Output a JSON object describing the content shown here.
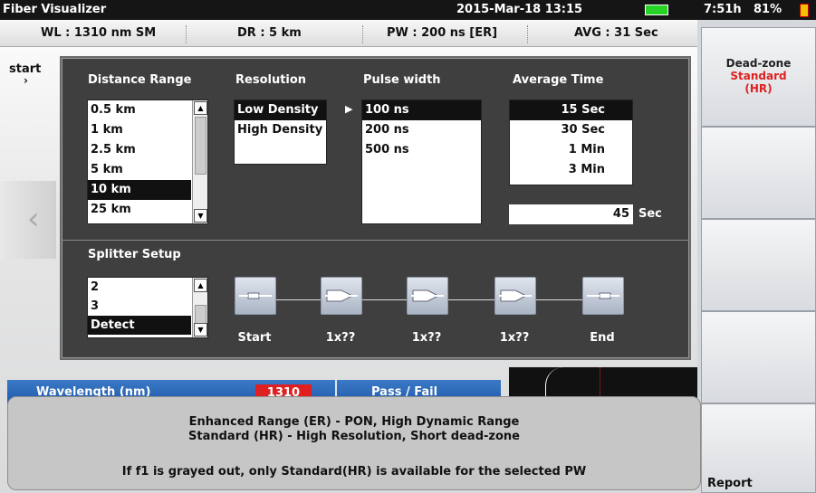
{
  "topbar": {
    "app_title": "Fiber Visualizer",
    "datetime": "2015-Mar-18 13:15",
    "battery_time": "7:51h",
    "battery_percent": "81%"
  },
  "infobar": {
    "wl": "WL : 1310 nm SM",
    "dr": "DR : 5 km",
    "pw": "PW : 200 ns [ER]",
    "avg": "AVG : 31 Sec"
  },
  "background": {
    "start_label": "start",
    "wavelength_label": "Wavelength (nm)",
    "wavelength_value": "1310",
    "passfail_label": "Pass / Fail"
  },
  "dialog": {
    "distance_range": {
      "label": "Distance Range",
      "items": [
        "0.5 km",
        "1 km",
        "2.5 km",
        "5 km",
        "10 km",
        "25 km"
      ],
      "selected": "10 km"
    },
    "resolution": {
      "label": "Resolution",
      "items": [
        "Low Density",
        "High Density"
      ],
      "selected": "Low Density"
    },
    "pulse_width": {
      "label": "Pulse width",
      "items": [
        "100 ns",
        "200 ns",
        "500 ns"
      ],
      "selected": "100 ns"
    },
    "average_time": {
      "label": "Average Time",
      "items": [
        "15 Sec",
        "30 Sec",
        "1 Min",
        "3 Min"
      ],
      "selected": "15 Sec",
      "custom_value": "45",
      "custom_unit": "Sec"
    },
    "splitter": {
      "label": "Splitter Setup",
      "items": [
        "2",
        "3",
        "Detect"
      ],
      "selected": "Detect",
      "nodes": [
        "Start",
        "1x??",
        "1x??",
        "1x??",
        "End"
      ]
    }
  },
  "rightpanel": {
    "deadzone_title": "Dead-zone",
    "deadzone_value": "Standard",
    "deadzone_sub": "(HR)",
    "report_label": "Report"
  },
  "message": {
    "line1": "Enhanced Range (ER) - PON, High Dynamic Range",
    "line2": "Standard (HR) - High Resolution, Short dead-zone",
    "line3": "If f1 is grayed out, only Standard(HR) is available for the selected PW"
  },
  "colors": {
    "accent_red": "#e02020",
    "selection": "#111111",
    "dialog_bg": "#3f3f3f"
  }
}
